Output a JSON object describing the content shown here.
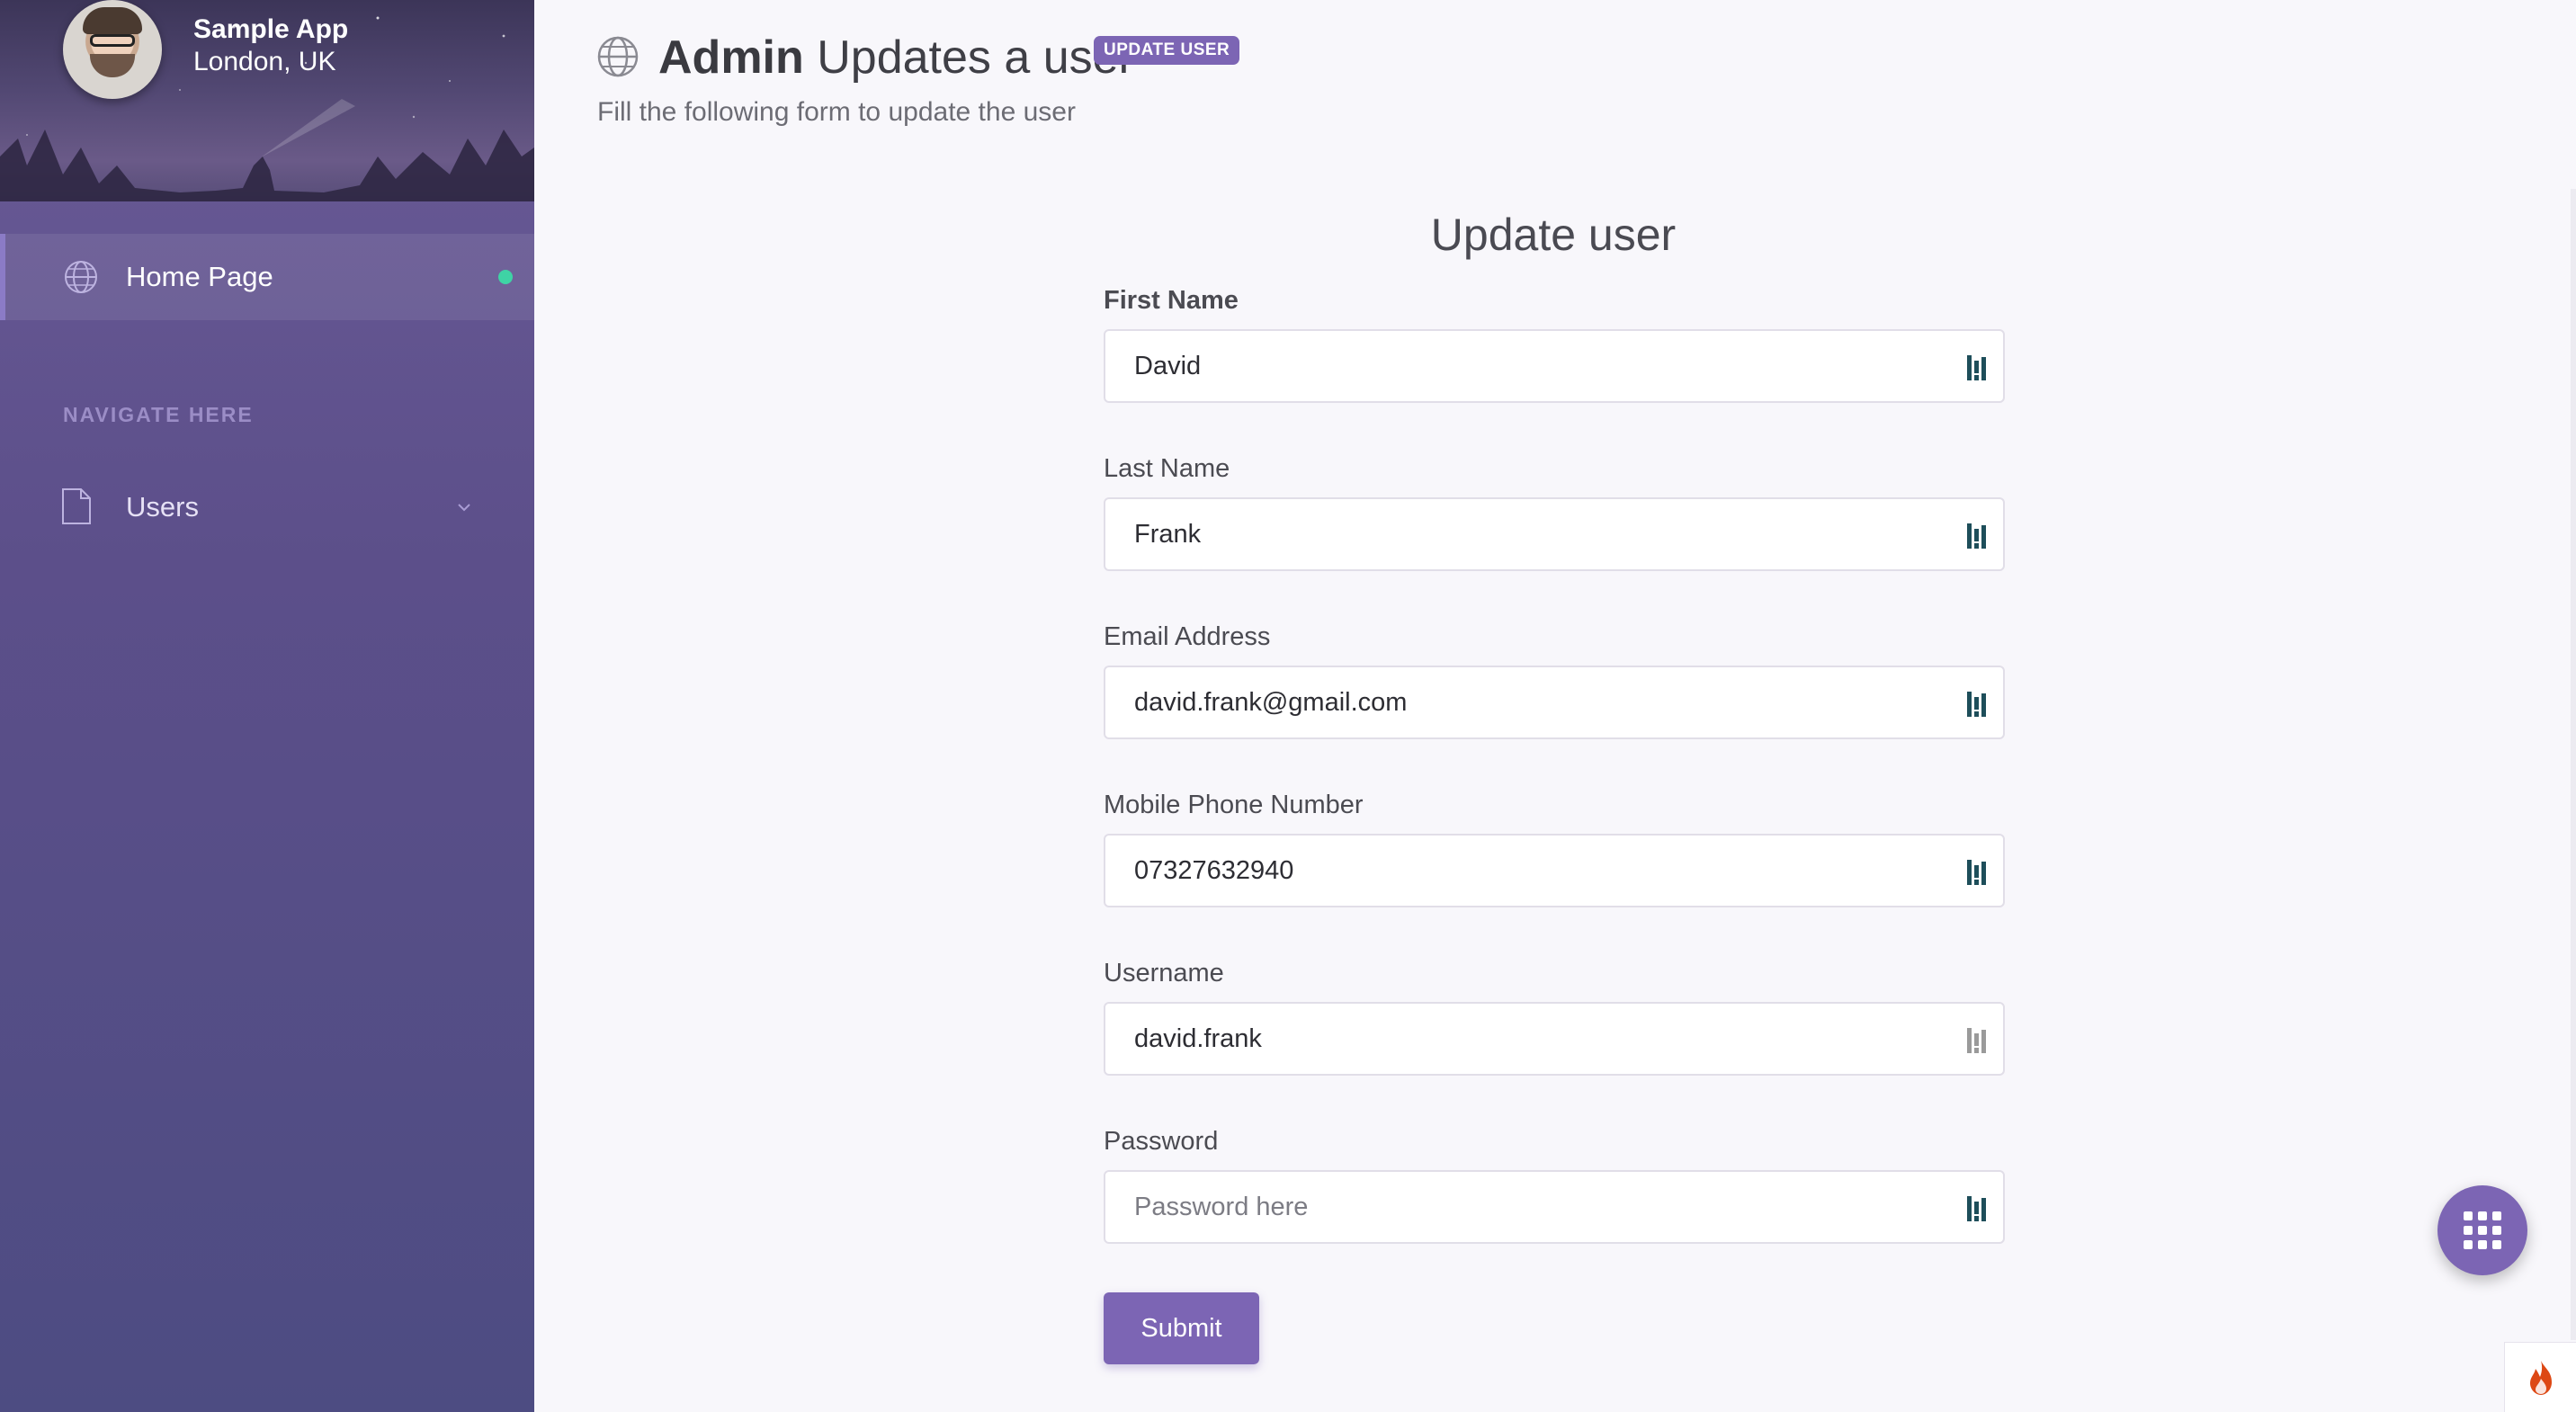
{
  "sidebar": {
    "app_name": "Sample App",
    "location": "London, UK",
    "items": [
      {
        "label": "Home Page",
        "icon": "globe-icon",
        "active": true
      },
      {
        "label": "Users",
        "icon": "file-icon",
        "expandable": true
      }
    ],
    "section_title": "NAVIGATE HERE"
  },
  "header": {
    "title_bold": "Admin",
    "title_rest": "Updates a user",
    "badge": "UPDATE USER",
    "subtitle": "Fill the following form to update the user"
  },
  "form": {
    "title": "Update user",
    "fields": [
      {
        "label": "First Name",
        "value": "David",
        "placeholder": ""
      },
      {
        "label": "Last Name",
        "value": "Frank",
        "placeholder": ""
      },
      {
        "label": "Email Address",
        "value": "david.frank@gmail.com",
        "placeholder": ""
      },
      {
        "label": "Mobile Phone Number",
        "value": "07327632940",
        "placeholder": ""
      },
      {
        "label": "Username",
        "value": "david.frank",
        "placeholder": ""
      },
      {
        "label": "Password",
        "value": "",
        "placeholder": "Password here"
      }
    ],
    "submit_label": "Submit"
  },
  "colors": {
    "accent": "#7c65b4",
    "sidebar": "#5c4f8a",
    "active_dot": "#3fd3a5"
  }
}
